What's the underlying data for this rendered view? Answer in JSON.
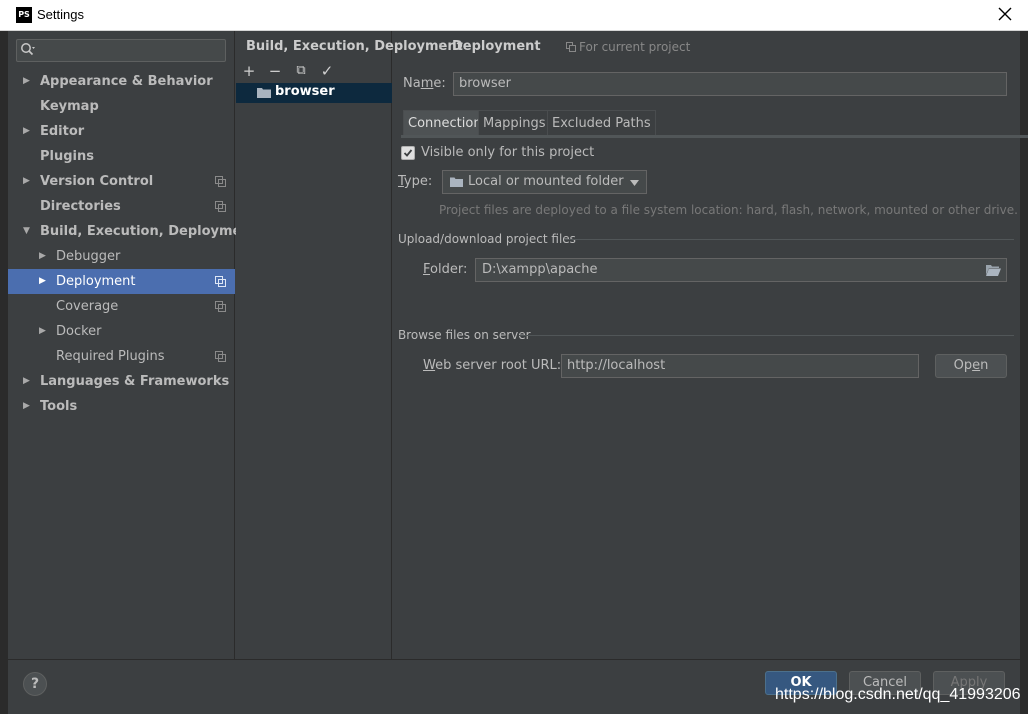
{
  "window": {
    "title": "Settings",
    "app_icon": "PS"
  },
  "sidebar": {
    "search": {
      "value": "",
      "placeholder": ""
    },
    "items": [
      {
        "label": "Appearance & Behavior",
        "bold": true,
        "arrow": "▶",
        "copy": false
      },
      {
        "label": "Keymap",
        "bold": true,
        "arrow": "",
        "copy": false
      },
      {
        "label": "Editor",
        "bold": true,
        "arrow": "▶",
        "copy": false
      },
      {
        "label": "Plugins",
        "bold": true,
        "arrow": "",
        "copy": false
      },
      {
        "label": "Version Control",
        "bold": true,
        "arrow": "▶",
        "copy": true
      },
      {
        "label": "Directories",
        "bold": true,
        "arrow": "",
        "copy": true
      },
      {
        "label": "Build, Execution, Deployment",
        "bold": true,
        "arrow": "▼",
        "copy": false
      },
      {
        "label": "Debugger",
        "bold": false,
        "arrow": "▶",
        "copy": false
      },
      {
        "label": "Deployment",
        "bold": false,
        "arrow": "▶",
        "copy": true,
        "selected": true
      },
      {
        "label": "Coverage",
        "bold": false,
        "arrow": "",
        "copy": true
      },
      {
        "label": "Docker",
        "bold": false,
        "arrow": "▶",
        "copy": false
      },
      {
        "label": "Required Plugins",
        "bold": false,
        "arrow": "",
        "copy": true
      },
      {
        "label": "Languages & Frameworks",
        "bold": true,
        "arrow": "▶",
        "copy": false
      },
      {
        "label": "Tools",
        "bold": true,
        "arrow": "▶",
        "copy": false
      }
    ]
  },
  "breadcrumb": {
    "parent": "Build, Execution, Deployment",
    "separator": "›",
    "current": "Deployment",
    "scope": "For current project"
  },
  "servers": {
    "toolbar": [
      "+",
      "−",
      "⧉",
      "✓"
    ],
    "items": [
      "browser"
    ]
  },
  "form": {
    "name_label_pre": "Na",
    "name_label_u": "m",
    "name_label_post": "e:",
    "name_value": "browser",
    "tabs": [
      "Connection",
      "Mappings",
      "Excluded Paths"
    ],
    "visible_only": {
      "label": "Visible only for this project",
      "checked": true
    },
    "type_label_u": "T",
    "type_label_post": "ype:",
    "type_value": "Local or mounted folder",
    "type_hint": "Project files are deployed to a file system location: hard, flash, network, mounted or other drive.",
    "upload_section": "Upload/download project files",
    "folder_label_u": "F",
    "folder_label_post": "older:",
    "folder_value": "D:\\xampp\\apache",
    "browse_section": "Browse files on server",
    "url_label_u": "W",
    "url_label_post": "eb server root URL:",
    "url_value": "http://localhost",
    "open_pre": "Op",
    "open_u": "e",
    "open_post": "n"
  },
  "footer": {
    "help": "?",
    "ok": "OK",
    "cancel": "Cancel",
    "apply": "Apply"
  },
  "watermark": "https://blog.csdn.net/qq_41993206",
  "colors": {
    "selection": "#4b6eaf",
    "background": "#3c3f41",
    "primary_button": "#365880"
  }
}
